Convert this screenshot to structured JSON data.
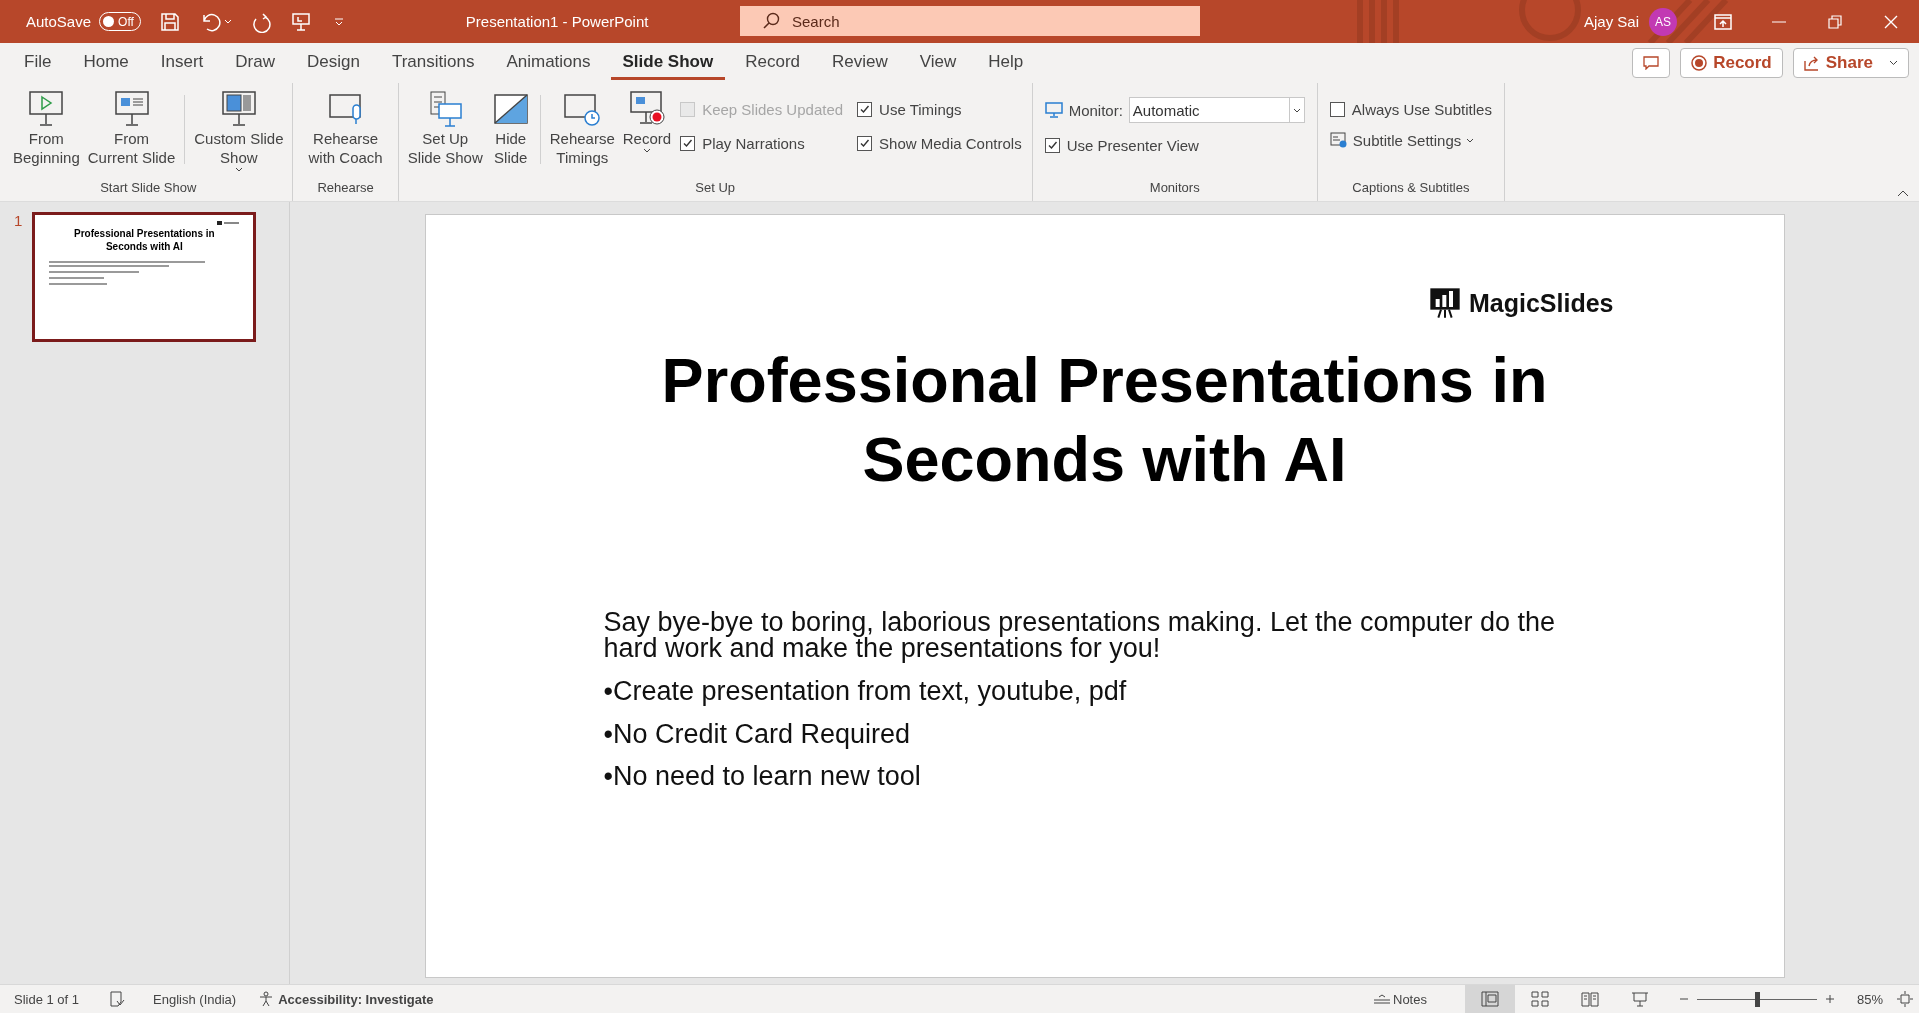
{
  "title_bar": {
    "autosave_label": "AutoSave",
    "autosave_toggle": {
      "label": "Off",
      "on": false
    },
    "document_title": "Presentation1  -  PowerPoint",
    "search": {
      "placeholder": "Search"
    },
    "user_name": "Ajay Sai",
    "avatar_initials": "AS"
  },
  "ribbon_tabs": [
    {
      "label": "File",
      "selected": false
    },
    {
      "label": "Home",
      "selected": false
    },
    {
      "label": "Insert",
      "selected": false
    },
    {
      "label": "Draw",
      "selected": false
    },
    {
      "label": "Design",
      "selected": false
    },
    {
      "label": "Transitions",
      "selected": false
    },
    {
      "label": "Animations",
      "selected": false
    },
    {
      "label": "Slide Show",
      "selected": true
    },
    {
      "label": "Record",
      "selected": false
    },
    {
      "label": "Review",
      "selected": false
    },
    {
      "label": "View",
      "selected": false
    },
    {
      "label": "Help",
      "selected": false
    }
  ],
  "ribbon_actions": {
    "record": "Record",
    "share": "Share"
  },
  "start_slide_show": {
    "label": "Start Slide Show",
    "buttons": [
      {
        "lines": [
          "From",
          "Beginning"
        ],
        "dropdown": false
      },
      {
        "lines": [
          "From",
          "Current Slide"
        ],
        "dropdown": false
      },
      {
        "lines": [
          "Custom Slide",
          "Show"
        ],
        "dropdown": true
      }
    ]
  },
  "rehearse": {
    "label": "Rehearse",
    "buttons": [
      {
        "lines": [
          "Rehearse",
          "with Coach"
        ],
        "dropdown": false
      }
    ]
  },
  "set_up": {
    "label": "Set Up",
    "buttons": [
      {
        "lines": [
          "Set Up",
          "Slide Show"
        ],
        "dropdown": false
      },
      {
        "lines": [
          "Hide",
          "Slide"
        ],
        "dropdown": false
      },
      {
        "lines": [
          "Rehearse",
          "Timings"
        ],
        "dropdown": false
      },
      {
        "lines": [
          "Record"
        ],
        "dropdown": true
      }
    ],
    "checkboxes": [
      {
        "label": "Keep Slides Updated",
        "checked": false,
        "disabled": true
      },
      {
        "label": "Play Narrations",
        "checked": true,
        "disabled": false
      },
      {
        "label": "Use Timings",
        "checked": true,
        "disabled": false
      },
      {
        "label": "Show Media Controls",
        "checked": true,
        "disabled": false
      }
    ]
  },
  "monitors": {
    "label": "Monitors",
    "monitor_label": "Monitor:",
    "monitor_value": "Automatic",
    "presenter_view": {
      "label": "Use Presenter View",
      "checked": true
    }
  },
  "captions": {
    "label": "Captions & Subtitles",
    "always_subtitles": {
      "label": "Always Use Subtitles",
      "checked": false
    },
    "subtitle_settings": "Subtitle Settings"
  },
  "thumbnail": {
    "number": "1",
    "selected": true,
    "title": "Professional Presentations in Seconds with AI"
  },
  "slide": {
    "logo": "MagicSlides",
    "title": [
      "Professional Presentations in",
      "Seconds with AI"
    ],
    "intro": "Say bye-bye to boring, laborious presentations making. Let the computer do the hard work and make the presentations for you!",
    "bullets": [
      "•Create presentation from text, youtube, pdf",
      "•No Credit Card Required",
      "•No need to learn new tool"
    ]
  },
  "status_bar": {
    "slide_count": "Slide 1 of 1",
    "language": "English (India)",
    "accessibility": "Accessibility: Investigate",
    "notes": "Notes",
    "views": [
      {
        "selected": true
      },
      {
        "selected": false
      },
      {
        "selected": false
      },
      {
        "selected": false
      }
    ],
    "zoom": {
      "level": 0.5,
      "reading": "85%"
    }
  }
}
